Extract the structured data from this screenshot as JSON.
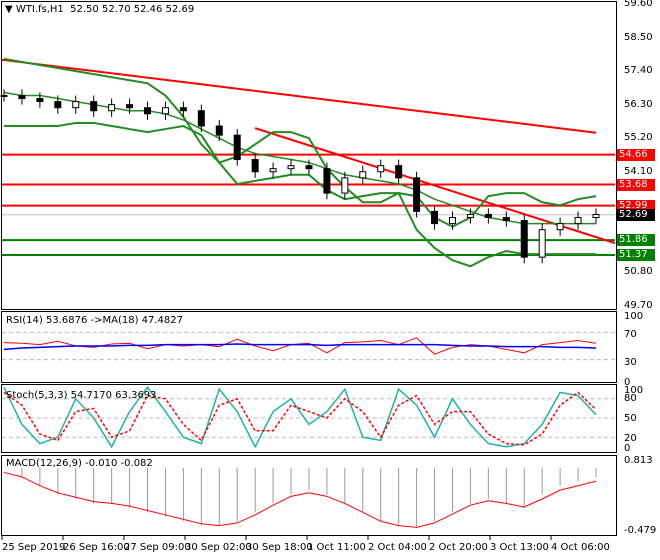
{
  "header": {
    "symbol": "WTI.fs,H1",
    "ohlc": "52.50 52.70 52.46 52.69"
  },
  "price_axis": [
    "59.60",
    "58.50",
    "57.40",
    "56.30",
    "55.20",
    "54.10",
    "50.80",
    "49.70"
  ],
  "levels": [
    {
      "value": "54.66",
      "price": 54.66,
      "color": "#ff0000"
    },
    {
      "value": "53.68",
      "price": 53.68,
      "color": "#ff0000"
    },
    {
      "value": "52.99",
      "price": 52.99,
      "color": "#ff0000"
    },
    {
      "value": "51.86",
      "price": 51.86,
      "color": "#008000"
    },
    {
      "value": "51.37",
      "price": 51.37,
      "color": "#008000"
    }
  ],
  "current_price": {
    "value": "52.69",
    "price": 52.69
  },
  "rsi": {
    "label": "RSI(14) 53.6876  ->MA(18) 47.4827",
    "axis": [
      "100",
      "70",
      "30",
      "0"
    ]
  },
  "stoch": {
    "label": "Stoch(5,3,3) 54.7170 63.3693",
    "axis": [
      "100",
      "80",
      "50",
      "20",
      "0"
    ]
  },
  "macd": {
    "label": "MACD(12,26,9) -0.010 -0.082",
    "axis": [
      "0.813",
      "-0.479"
    ]
  },
  "time_axis": [
    "25 Sep 2019",
    "26 Sep 16:00",
    "27 Sep 09:00",
    "30 Sep 02:00",
    "30 Sep 18:00",
    "1 Oct 11:00",
    "2 Oct 04:00",
    "2 Oct 20:00",
    "3 Oct 13:00",
    "4 Oct 06:00"
  ],
  "chart_data": {
    "type": "line",
    "close": [
      56.6,
      56.5,
      56.4,
      56.2,
      56.4,
      56.1,
      56.3,
      56.2,
      56.0,
      56.2,
      56.1,
      55.6,
      55.3,
      54.5,
      54.1,
      54.2,
      54.3,
      54.2,
      53.4,
      53.9,
      54.1,
      54.3,
      53.9,
      52.8,
      52.4,
      52.6,
      52.7,
      52.6,
      52.5,
      51.3,
      52.2,
      52.4,
      52.6,
      52.7
    ],
    "bb_upper": [
      57.8,
      57.7,
      57.6,
      57.5,
      57.4,
      57.3,
      57.2,
      57.1,
      57.0,
      56.6,
      55.9,
      55.0,
      54.4,
      54.6,
      55.0,
      55.4,
      55.4,
      55.2,
      54.2,
      53.6,
      53.1,
      53.1,
      53.4,
      53.3,
      52.6,
      52.3,
      52.6,
      53.3,
      53.4,
      53.4,
      53.1,
      53.0,
      53.2,
      53.3
    ],
    "bb_mid": [
      56.7,
      56.6,
      56.6,
      56.5,
      56.4,
      56.3,
      56.2,
      56.1,
      56.1,
      56.0,
      55.8,
      55.5,
      55.2,
      54.9,
      54.7,
      54.6,
      54.5,
      54.4,
      54.2,
      54.0,
      53.9,
      53.8,
      53.7,
      53.5,
      53.2,
      53.0,
      52.8,
      52.6,
      52.5,
      52.4,
      52.4,
      52.4,
      52.4,
      52.4
    ],
    "bb_lower": [
      55.6,
      55.6,
      55.6,
      55.6,
      55.7,
      55.7,
      55.6,
      55.5,
      55.4,
      55.5,
      55.6,
      55.3,
      54.4,
      53.7,
      53.8,
      53.9,
      54.0,
      54.0,
      53.5,
      53.2,
      53.3,
      53.4,
      53.4,
      52.2,
      51.6,
      51.2,
      51.0,
      51.3,
      51.5,
      51.4,
      51.4,
      51.4,
      51.4,
      51.4
    ],
    "trend1": [
      57.77,
      55.38
    ],
    "trend2": [
      55.53,
      51.76
    ],
    "rsi": [
      55,
      54,
      52,
      57,
      50,
      48,
      53,
      54,
      46,
      52,
      50,
      52,
      49,
      60,
      50,
      43,
      52,
      54,
      40,
      55,
      56,
      58,
      52,
      62,
      38,
      48,
      52,
      50,
      45,
      40,
      52,
      55,
      58,
      54
    ],
    "rsi_ma": [
      45,
      47,
      48,
      49,
      50,
      50,
      50,
      51,
      51,
      52,
      52,
      52,
      52,
      53,
      52,
      52,
      52,
      52,
      51,
      52,
      52,
      52,
      52,
      52,
      52,
      51,
      50,
      50,
      49,
      49,
      49,
      48,
      48,
      47
    ],
    "stoch_main": [
      98,
      40,
      10,
      20,
      80,
      50,
      5,
      60,
      98,
      60,
      20,
      10,
      95,
      60,
      5,
      60,
      80,
      40,
      60,
      95,
      20,
      15,
      95,
      70,
      20,
      80,
      40,
      10,
      5,
      10,
      40,
      90,
      85,
      55
    ],
    "stoch_signal": [
      90,
      70,
      25,
      15,
      60,
      65,
      20,
      30,
      85,
      80,
      40,
      15,
      70,
      80,
      30,
      30,
      70,
      60,
      50,
      80,
      60,
      20,
      70,
      85,
      40,
      60,
      60,
      25,
      10,
      8,
      25,
      70,
      90,
      63
    ],
    "macd_hist": [
      0.2,
      0.1,
      0.0,
      -0.1,
      -0.15,
      -0.2,
      -0.2,
      -0.25,
      -0.3,
      -0.35,
      -0.4,
      -0.45,
      -0.45,
      -0.4,
      -0.3,
      -0.2,
      -0.1,
      -0.05,
      -0.1,
      -0.2,
      -0.3,
      -0.4,
      -0.45,
      -0.47,
      -0.4,
      -0.3,
      -0.2,
      -0.15,
      -0.2,
      -0.25,
      -0.1,
      0.0,
      0.05,
      0.1
    ],
    "macd_signal": [
      0.15,
      0.1,
      0.0,
      -0.08,
      -0.13,
      -0.18,
      -0.2,
      -0.23,
      -0.28,
      -0.33,
      -0.38,
      -0.43,
      -0.45,
      -0.42,
      -0.33,
      -0.22,
      -0.12,
      -0.08,
      -0.12,
      -0.2,
      -0.3,
      -0.4,
      -0.45,
      -0.47,
      -0.42,
      -0.32,
      -0.22,
      -0.17,
      -0.2,
      -0.24,
      -0.15,
      -0.05,
      0.0,
      0.05
    ]
  }
}
